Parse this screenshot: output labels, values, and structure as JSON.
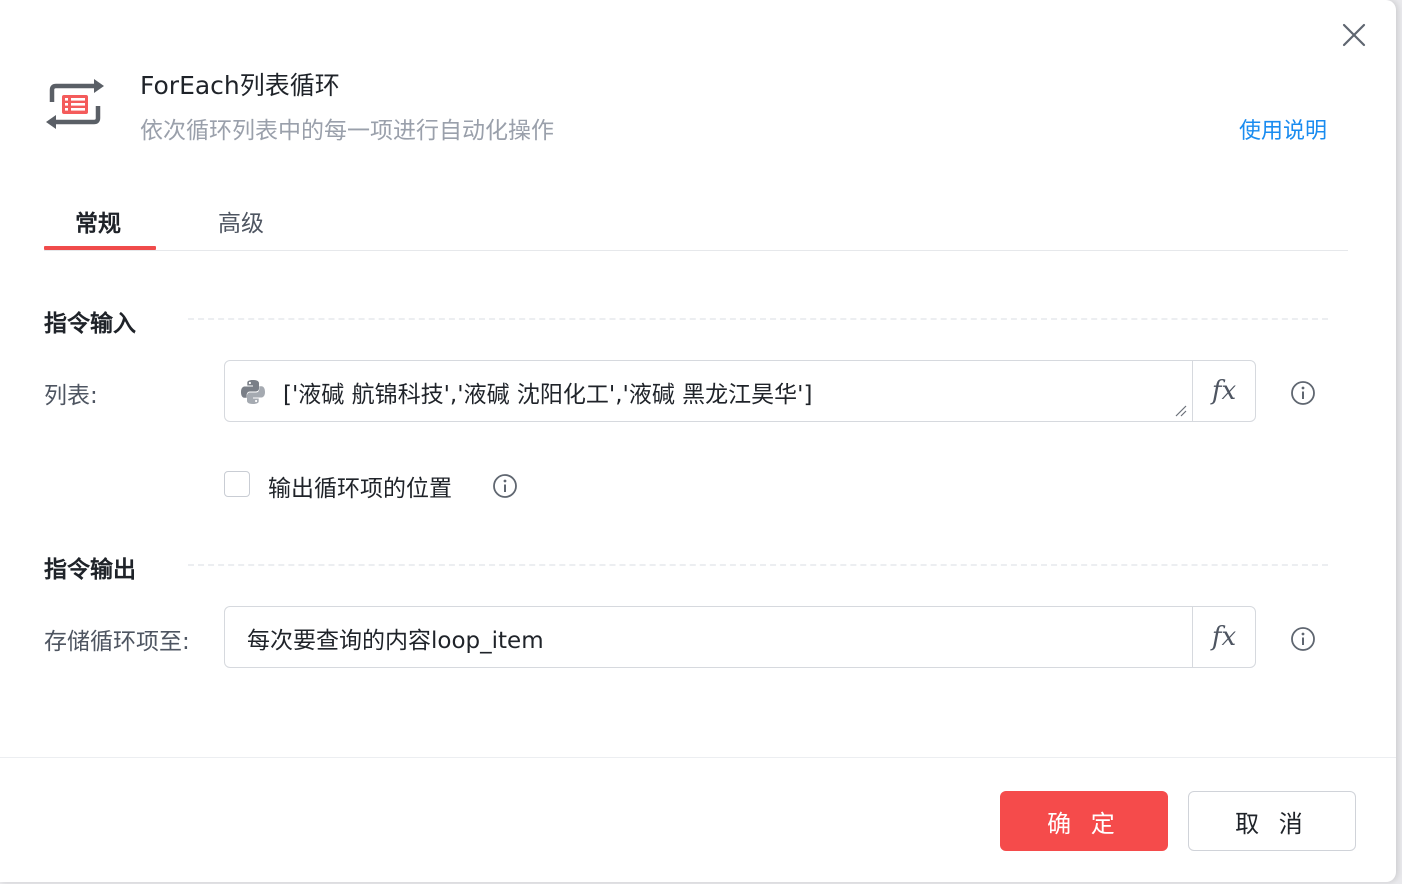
{
  "dialog": {
    "title": "ForEach列表循环",
    "subtitle": "依次循环列表中的每一项进行自动化操作",
    "help_link": "使用说明"
  },
  "tabs": [
    {
      "label": "常规",
      "active": true
    },
    {
      "label": "高级",
      "active": false
    }
  ],
  "sections": {
    "input": {
      "title": "指令输入",
      "list_field": {
        "label": "列表:",
        "value": "['液碱 航锦科技','液碱 沈阳化工','液碱 黑龙江昊华']",
        "fx_label": "fx"
      },
      "checkbox": {
        "label": "输出循环项的位置",
        "checked": false
      }
    },
    "output": {
      "title": "指令输出",
      "store_field": {
        "label": "存储循环项至:",
        "value": "每次要查询的内容loop_item",
        "fx_label": "fx"
      }
    }
  },
  "footer": {
    "confirm_label": "确 定",
    "cancel_label": "取 消"
  },
  "colors": {
    "accent": "#f54b4b",
    "link": "#1a8cf0",
    "tab_underline": "#f04b4b"
  },
  "icons": [
    "loop-list-icon",
    "close-icon",
    "python-icon",
    "fx-icon",
    "info-icon",
    "resize-grip-icon"
  ]
}
